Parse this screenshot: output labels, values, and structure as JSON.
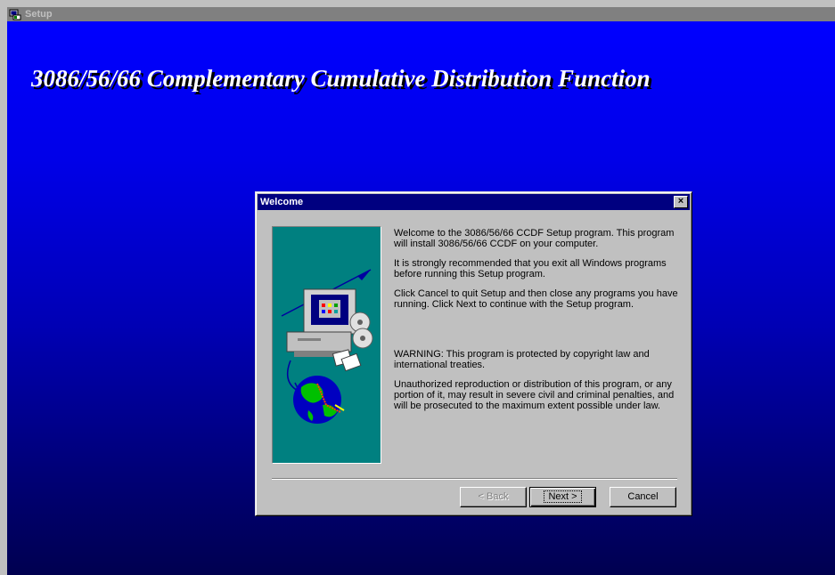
{
  "window": {
    "title": "Setup"
  },
  "banner": {
    "text": "3086/56/66 Complementary Cumulative Distribution Function"
  },
  "dialog": {
    "title": "Welcome",
    "close_glyph": "×",
    "paragraphs": [
      "Welcome to the 3086/56/66 CCDF Setup program. This program will install 3086/56/66 CCDF on your computer.",
      "It is strongly recommended that you exit all Windows programs before running this Setup program.",
      "Click Cancel to quit Setup and then close any programs you have running. Click Next to continue with the Setup program.",
      "WARNING: This program is protected by copyright law and international treaties.",
      "Unauthorized reproduction or distribution of this program, or any portion of it, may result in severe civil and criminal penalties, and will be prosecuted to the maximum extent possible under law."
    ],
    "buttons": {
      "back": "< Back",
      "next": "Next >",
      "cancel": "Cancel"
    }
  },
  "colors": {
    "desktop_top": "#0000ff",
    "desktop_bottom": "#000050",
    "title_active": "#000080",
    "art_bg": "#008080"
  },
  "icons": {
    "app": "setup-icon",
    "art": "computer-globe-illustration"
  }
}
